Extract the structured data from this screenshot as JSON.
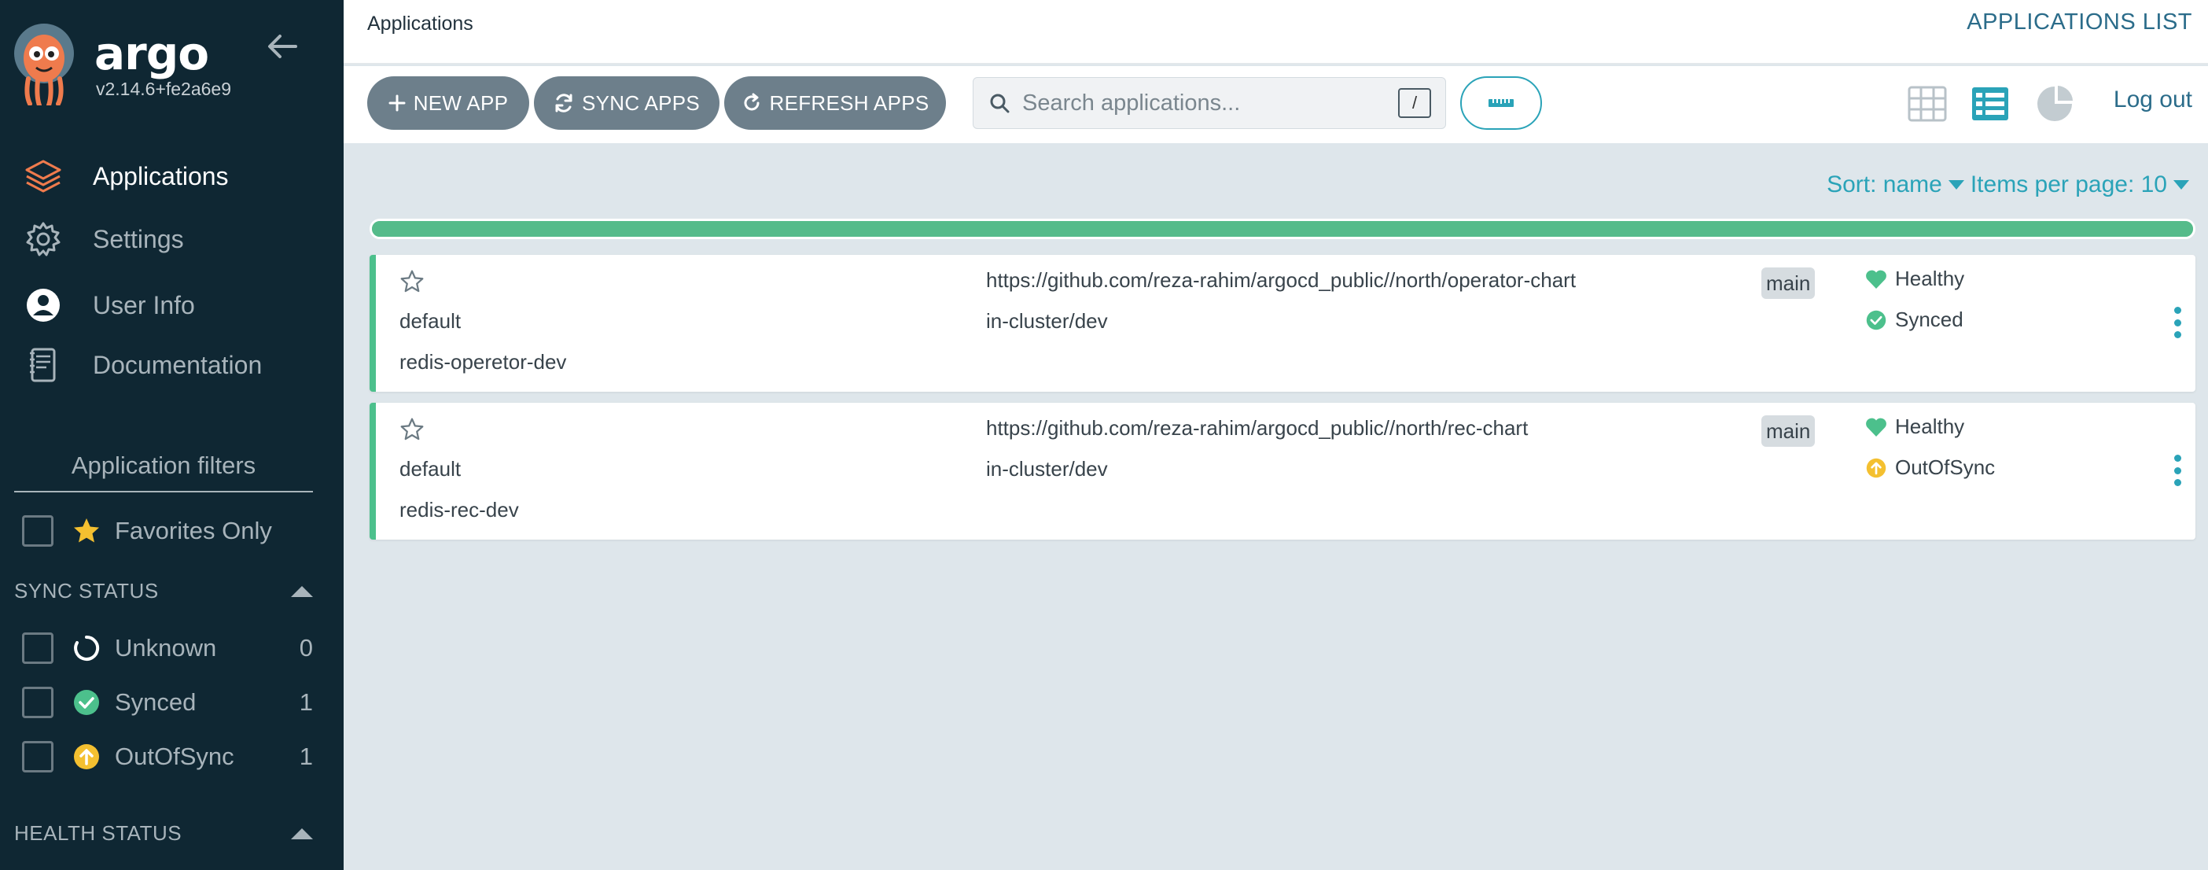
{
  "sidebar": {
    "brand": "argo",
    "version": "v2.14.6+fe2a6e9",
    "nav": [
      {
        "label": "Applications",
        "icon": "stack-icon",
        "active": true
      },
      {
        "label": "Settings",
        "icon": "gear-icon",
        "active": false
      },
      {
        "label": "User Info",
        "icon": "user-icon",
        "active": false
      },
      {
        "label": "Documentation",
        "icon": "book-icon",
        "active": false
      }
    ],
    "filters_title": "Application filters",
    "favorites_label": "Favorites Only",
    "sync_status": {
      "heading": "SYNC STATUS",
      "items": [
        {
          "label": "Unknown",
          "count": "0"
        },
        {
          "label": "Synced",
          "count": "1"
        },
        {
          "label": "OutOfSync",
          "count": "1"
        }
      ]
    },
    "health_status": {
      "heading": "HEALTH STATUS"
    }
  },
  "header": {
    "breadcrumb": "Applications",
    "title": "APPLICATIONS LIST"
  },
  "toolbar": {
    "new_app": "NEW APP",
    "sync_apps": "SYNC APPS",
    "refresh_apps": "REFRESH APPS",
    "search_placeholder": "Search applications...",
    "search_shortcut": "/",
    "logout": "Log out"
  },
  "list": {
    "sort_label": "Sort: name",
    "per_page_label": "Items per page: 10"
  },
  "apps": [
    {
      "project": "default",
      "name": "redis-operetor-dev",
      "repo": "https://github.com/reza-rahim/argocd_public//north/operator-chart",
      "destination": "in-cluster/dev",
      "revision": "main",
      "health": "Healthy",
      "sync": "Synced"
    },
    {
      "project": "default",
      "name": "redis-rec-dev",
      "repo": "https://github.com/reza-rahim/argocd_public//north/rec-chart",
      "destination": "in-cluster/dev",
      "revision": "main",
      "health": "Healthy",
      "sync": "OutOfSync"
    }
  ],
  "colors": {
    "sidebar_bg": "#0f2733",
    "accent": "#2aa3b8",
    "healthy": "#4cc08c",
    "out_of_sync": "#f4c030",
    "button_bg": "#6d7f8b",
    "content_bg": "#dee6eb"
  }
}
